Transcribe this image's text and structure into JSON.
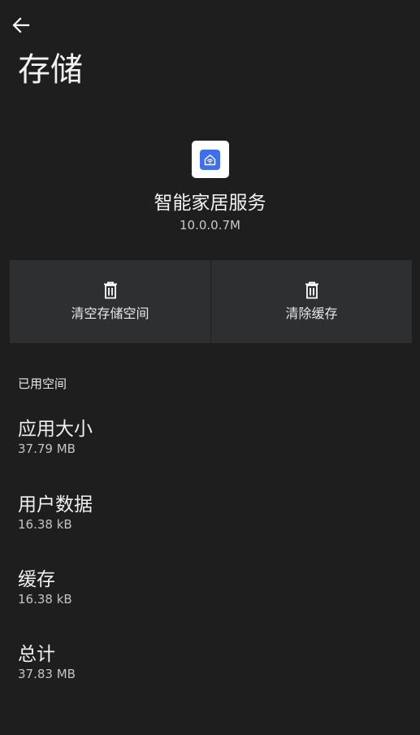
{
  "header": {
    "back_icon": "arrow-left-icon",
    "title": "存储"
  },
  "app": {
    "icon": "smart-home-icon",
    "name": "智能家居服务",
    "version": "10.0.0.7M",
    "accent_color": "#3f6ef2"
  },
  "actions": [
    {
      "icon": "trash-icon",
      "label": "清空存储空间"
    },
    {
      "icon": "trash-icon",
      "label": "清除缓存"
    }
  ],
  "usage": {
    "section_title": "已用空间",
    "items": [
      {
        "title": "应用大小",
        "value": "37.79 MB"
      },
      {
        "title": "用户数据",
        "value": "16.38 kB"
      },
      {
        "title": "缓存",
        "value": "16.38 kB"
      },
      {
        "title": "总计",
        "value": "37.83 MB"
      }
    ]
  }
}
